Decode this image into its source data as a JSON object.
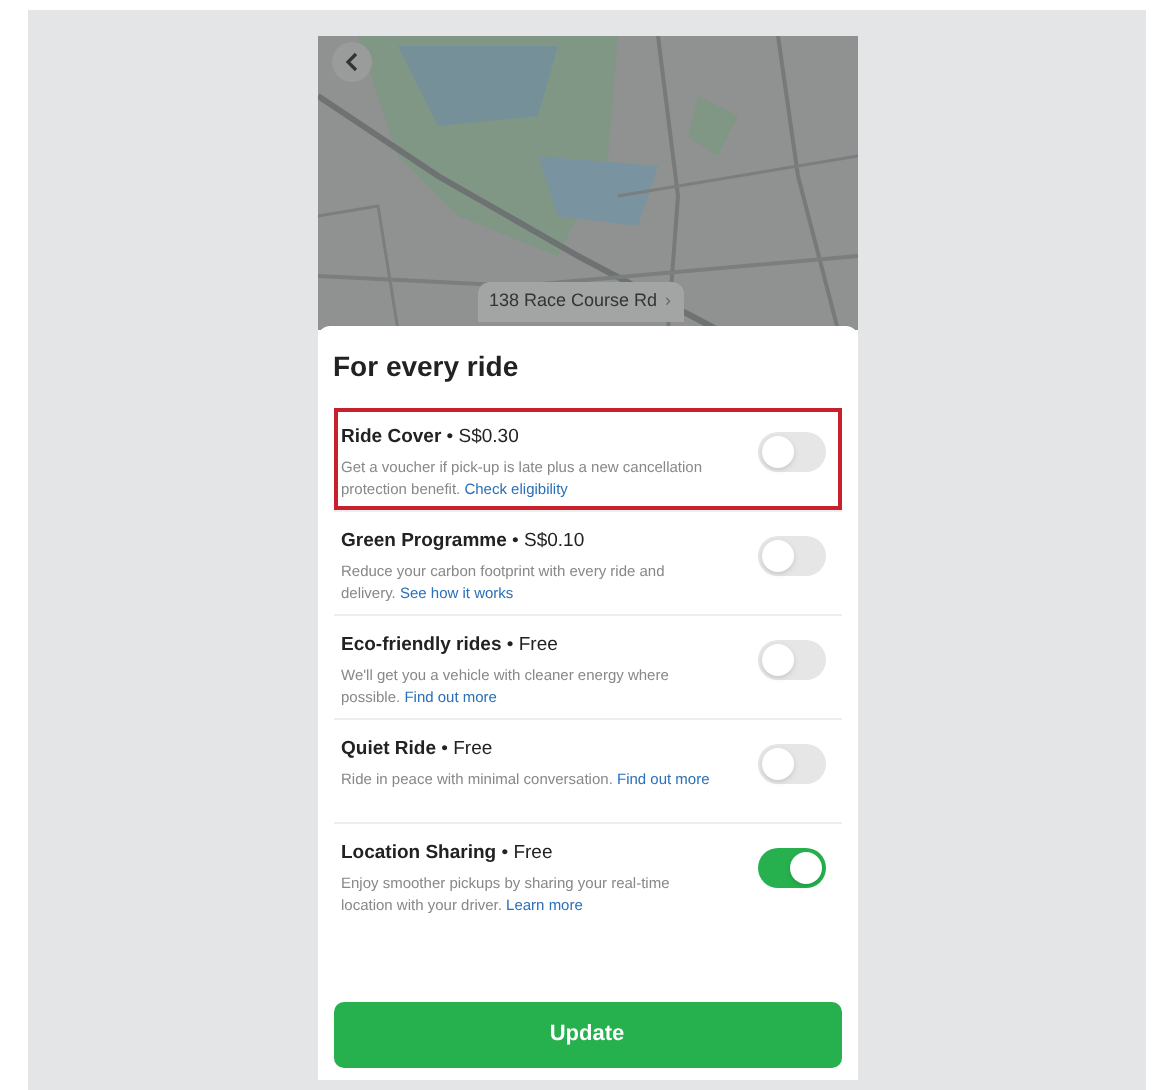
{
  "map": {
    "address": "138 Race Course Rd",
    "address_chevron": "›"
  },
  "section_title": "For every ride",
  "options": [
    {
      "name": "Ride Cover",
      "price": "• S$0.30",
      "description": "Get a voucher if pick-up is late plus a new cancellation protection benefit.",
      "link": "Check eligibility",
      "on": false,
      "highlighted": true
    },
    {
      "name": "Green Programme",
      "price": "• S$0.10",
      "description": "Reduce your carbon footprint with every ride and delivery.",
      "link": "See how it works",
      "on": false,
      "highlighted": false
    },
    {
      "name": "Eco-friendly rides",
      "price": "• Free",
      "description": "We'll get you a vehicle with cleaner energy where possible.",
      "link": "Find out more",
      "on": false,
      "highlighted": false
    },
    {
      "name": "Quiet Ride",
      "price": "• Free",
      "description": "Ride in peace with minimal conversation.",
      "link": "Find out more",
      "on": false,
      "highlighted": false
    },
    {
      "name": "Location Sharing",
      "price": "• Free",
      "description": "Enjoy smoother pickups by sharing your real-time location with your driver.",
      "link": "Learn more",
      "on": true,
      "highlighted": false
    }
  ],
  "update_button": "Update"
}
